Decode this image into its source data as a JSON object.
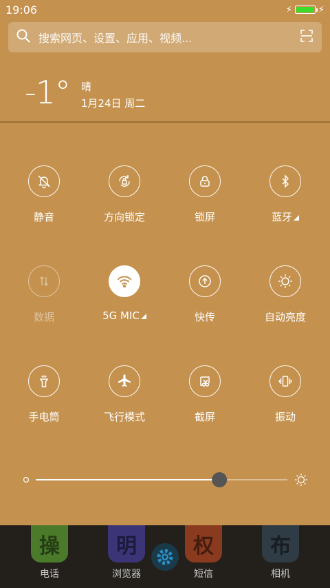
{
  "status_bar": {
    "time": "19:06",
    "battery_level": 1.0,
    "battery_color": "#3ddc2c"
  },
  "search": {
    "placeholder": "搜索网页、设置、应用、视频..."
  },
  "weather": {
    "temperature": "-1°",
    "condition": "晴",
    "date": "1月24日 周二"
  },
  "tiles": [
    {
      "label": "静音",
      "icon": "bell-off-icon",
      "state": "off"
    },
    {
      "label": "方向锁定",
      "icon": "rotation-lock-icon",
      "state": "off"
    },
    {
      "label": "锁屏",
      "icon": "lock-icon",
      "state": "off"
    },
    {
      "label": "蓝牙",
      "icon": "bluetooth-icon",
      "state": "off",
      "has_menu": true
    },
    {
      "label": "数据",
      "icon": "data-arrows-icon",
      "state": "disabled"
    },
    {
      "label": "5G  MIC",
      "icon": "wifi-icon",
      "state": "on",
      "has_menu": true
    },
    {
      "label": "快传",
      "icon": "quick-transfer-icon",
      "state": "off"
    },
    {
      "label": "自动亮度",
      "icon": "auto-brightness-icon",
      "state": "off"
    },
    {
      "label": "手电筒",
      "icon": "flashlight-icon",
      "state": "off"
    },
    {
      "label": "飞行模式",
      "icon": "airplane-icon",
      "state": "off"
    },
    {
      "label": "截屏",
      "icon": "screenshot-icon",
      "state": "off"
    },
    {
      "label": "振动",
      "icon": "vibrate-icon",
      "state": "off"
    }
  ],
  "brightness": {
    "value": 0.73
  },
  "dock": {
    "apps": [
      {
        "label": "电话",
        "glyph": "操",
        "color": "#4a7a2a"
      },
      {
        "label": "浏览器",
        "glyph": "明",
        "color": "#3b3577"
      },
      {
        "label": "短信",
        "glyph": "权",
        "color": "#8a3a1e"
      },
      {
        "label": "相机",
        "glyph": "布",
        "color": "#2f3b45"
      }
    ]
  },
  "colors": {
    "panel": "#c4914e",
    "accent": "#2a8fc7"
  }
}
